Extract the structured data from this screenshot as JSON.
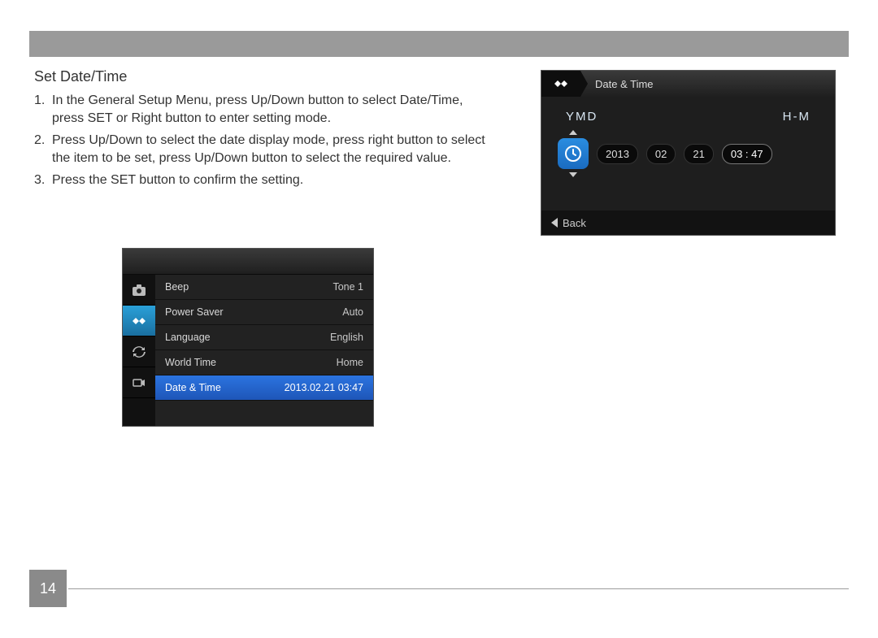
{
  "section": {
    "title": "Set Date/Time",
    "steps": [
      {
        "num": "1.",
        "text_before": "In the General Setup Menu, press Up/Down button to select Date/Time, press ",
        "kw": "SET",
        "text_after": " or Right button to enter setting mode."
      },
      {
        "num": "2.",
        "text_before": "Press Up/Down to select the date display mode, press right button to select the item to be set, press Up/Down button to select the required value.",
        "kw": "",
        "text_after": ""
      },
      {
        "num": "3.",
        "text_before": "Press the ",
        "kw": "SET",
        "text_after": " button to confirm the setting."
      }
    ]
  },
  "menu_screen": {
    "sidebar_icons": [
      "camera",
      "tools",
      "sync",
      "connect"
    ],
    "active_sidebar_index": 1,
    "rows": [
      {
        "label": "Beep",
        "value": "Tone 1",
        "selected": false
      },
      {
        "label": "Power Saver",
        "value": "Auto",
        "selected": false
      },
      {
        "label": "Language",
        "value": "English",
        "selected": false
      },
      {
        "label": "World Time",
        "value": "Home",
        "selected": false
      },
      {
        "label": "Date & Time",
        "value": "2013.02.21  03:47",
        "selected": true
      }
    ]
  },
  "dt_screen": {
    "header_title": "Date & Time",
    "ymd_label": "YMD",
    "hm_label": "H-M",
    "year": "2013",
    "month": "02",
    "day": "21",
    "time": "03 : 47",
    "back_label": "Back"
  },
  "page_number": "14"
}
